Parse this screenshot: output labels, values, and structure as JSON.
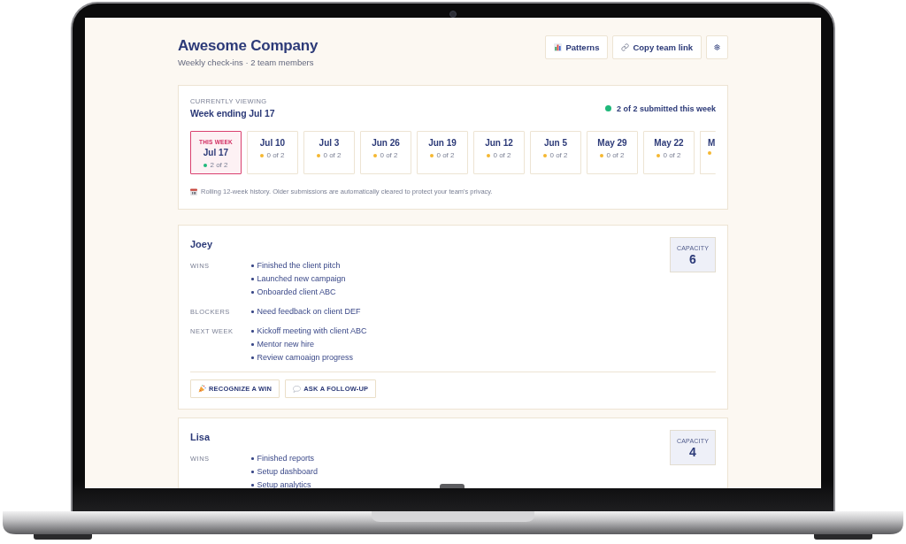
{
  "company": {
    "name": "Awesome Company",
    "subtitle": "Weekly check-ins · 2 team members"
  },
  "toolbar": [
    {
      "kind": "chart",
      "label": "Patterns"
    },
    {
      "kind": "link",
      "label": "Copy team link"
    },
    {
      "kind": "settings"
    }
  ],
  "week_panel": {
    "eyebrow": "CURRENTLY VIEWING",
    "heading": "Week ending Jul 17",
    "status": "2 of 2 submitted this week",
    "weeks": [
      {
        "tag": "THIS WEEK",
        "label": "Jul 17",
        "count": "2 of 2",
        "color": "#1fb87a",
        "selected": true
      },
      {
        "label": "Jul 10",
        "count": "0 of 2",
        "color": "#f5b731",
        "selected": false
      },
      {
        "label": "Jul 3",
        "count": "0 of 2",
        "color": "#f5b731",
        "selected": false
      },
      {
        "label": "Jun 26",
        "count": "0 of 2",
        "color": "#f5b731",
        "selected": false
      },
      {
        "label": "Jun 19",
        "count": "0 of 2",
        "color": "#f5b731",
        "selected": false
      },
      {
        "label": "Jun 12",
        "count": "0 of 2",
        "color": "#f5b731",
        "selected": false
      },
      {
        "label": "Jun 5",
        "count": "0 of 2",
        "color": "#f5b731",
        "selected": false
      },
      {
        "label": "May 29",
        "count": "0 of 2",
        "color": "#f5b731",
        "selected": false
      },
      {
        "label": "May 22",
        "count": "0 of 2",
        "color": "#f5b731",
        "selected": false
      },
      {
        "label": "M",
        "color": "#f5b731",
        "selected": false
      }
    ],
    "note": "Rolling 12-week history. Older submissions are automatically cleared to protect your team's privacy."
  },
  "members": [
    {
      "name": "Joey",
      "capacity_label": "CAPACITY",
      "capacity": "6",
      "sections": [
        {
          "label": "WINS",
          "items": [
            "Finished the client pitch",
            "Launched new campaign",
            "Onboarded client ABC"
          ]
        },
        {
          "label": "BLOCKERS",
          "items": [
            "Need feedback on client DEF"
          ]
        },
        {
          "label": "NEXT WEEK",
          "items": [
            "Kickoff meeting with client ABC",
            "Mentor new hire",
            "Review camoaign progress"
          ]
        }
      ],
      "actions": [
        {
          "kind": "celebrate",
          "label": "RECOGNIZE A WIN"
        },
        {
          "kind": "comment",
          "label": "ASK A FOLLOW-UP"
        }
      ]
    },
    {
      "name": "Lisa",
      "capacity_label": "CAPACITY",
      "capacity": "4",
      "sections": [
        {
          "label": "WINS",
          "items": [
            "Finished reports",
            "Setup dashboard",
            "Setup analytics"
          ]
        }
      ]
    }
  ]
}
